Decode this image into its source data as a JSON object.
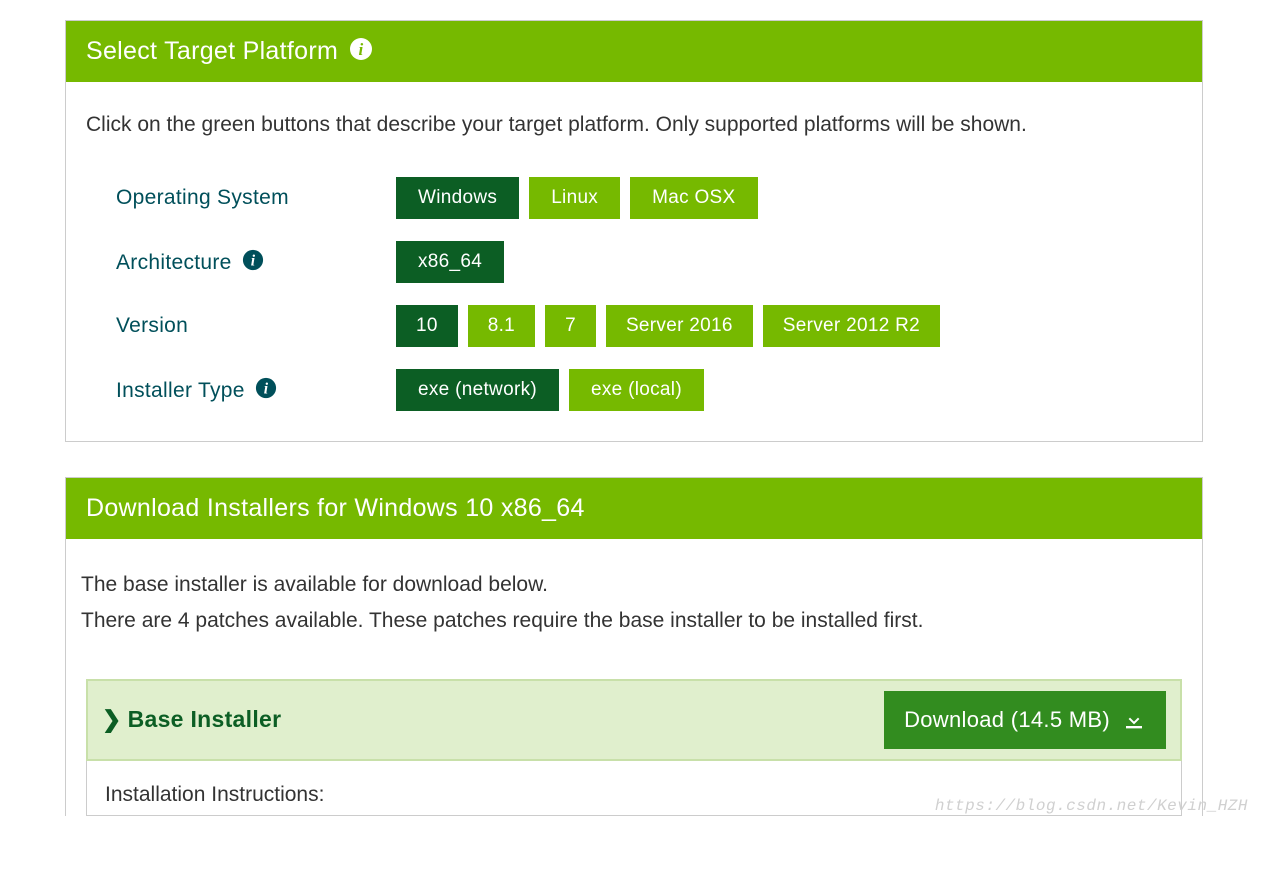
{
  "select": {
    "header": "Select Target Platform",
    "instruction": "Click on the green buttons that describe your target platform. Only supported platforms will be shown.",
    "rows": {
      "os": {
        "label": "Operating System",
        "options": [
          "Windows",
          "Linux",
          "Mac OSX"
        ],
        "selected_index": 0
      },
      "arch": {
        "label": "Architecture",
        "options": [
          "x86_64"
        ],
        "selected_index": 0
      },
      "version": {
        "label": "Version",
        "options": [
          "10",
          "8.1",
          "7",
          "Server 2016",
          "Server 2012 R2"
        ],
        "selected_index": 0
      },
      "installer": {
        "label": "Installer Type",
        "options": [
          "exe (network)",
          "exe (local)"
        ],
        "selected_index": 0
      }
    }
  },
  "downloads": {
    "header": "Download Installers for Windows 10 x86_64",
    "desc_line1": "The base installer is available for download below.",
    "desc_line2": "There are 4 patches available. These patches require the base installer to be installed first.",
    "base_title": "Base Installer",
    "download_label": "Download (14.5 MB)",
    "install_instructions_label": "Installation Instructions:"
  },
  "watermark": "https://blog.csdn.net/Kevin_HZH"
}
